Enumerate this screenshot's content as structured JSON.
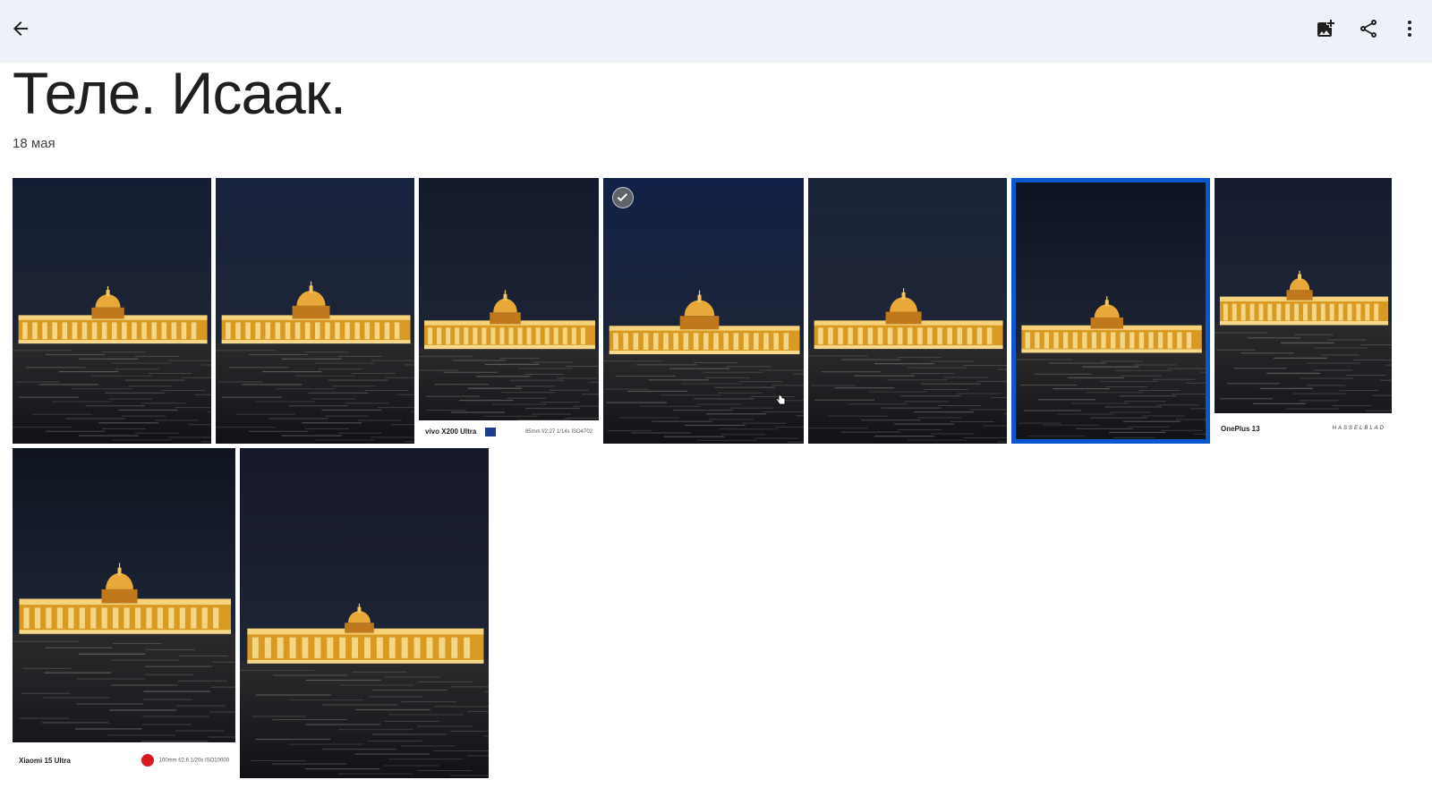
{
  "header": {
    "back_icon": "arrow-back-icon",
    "add_icon": "add-photo-icon",
    "share_icon": "share-icon",
    "more_icon": "more-vert-icon"
  },
  "album": {
    "title": "Теле. Исаак.",
    "date": "18 мая"
  },
  "photos": [
    {
      "id": "photo-1",
      "selected": false,
      "checked": false
    },
    {
      "id": "photo-2",
      "selected": false,
      "checked": false
    },
    {
      "id": "photo-3",
      "selected": false,
      "checked": false,
      "footer": {
        "brand": "vivo X200 Ultra",
        "meta": "85mm f/2.27 1/14s ISO4702"
      }
    },
    {
      "id": "photo-4",
      "selected": false,
      "checked": true
    },
    {
      "id": "photo-5",
      "selected": false,
      "checked": false
    },
    {
      "id": "photo-6",
      "selected": true,
      "checked": false
    },
    {
      "id": "photo-7",
      "selected": false,
      "checked": false,
      "footer": {
        "brand": "OnePlus 13",
        "meta": "HASSELBLAD"
      }
    },
    {
      "id": "photo-8",
      "selected": false,
      "checked": false,
      "footer": {
        "brand": "Xiaomi 15 Ultra",
        "meta": "100mm f/2.6 1/20s ISO10000"
      }
    },
    {
      "id": "photo-9",
      "selected": false,
      "checked": false
    }
  ],
  "colors": {
    "topbar": "#eef1f8",
    "selection": "#0b57d0",
    "sky": "#15203a",
    "lights": "#f2b632"
  }
}
